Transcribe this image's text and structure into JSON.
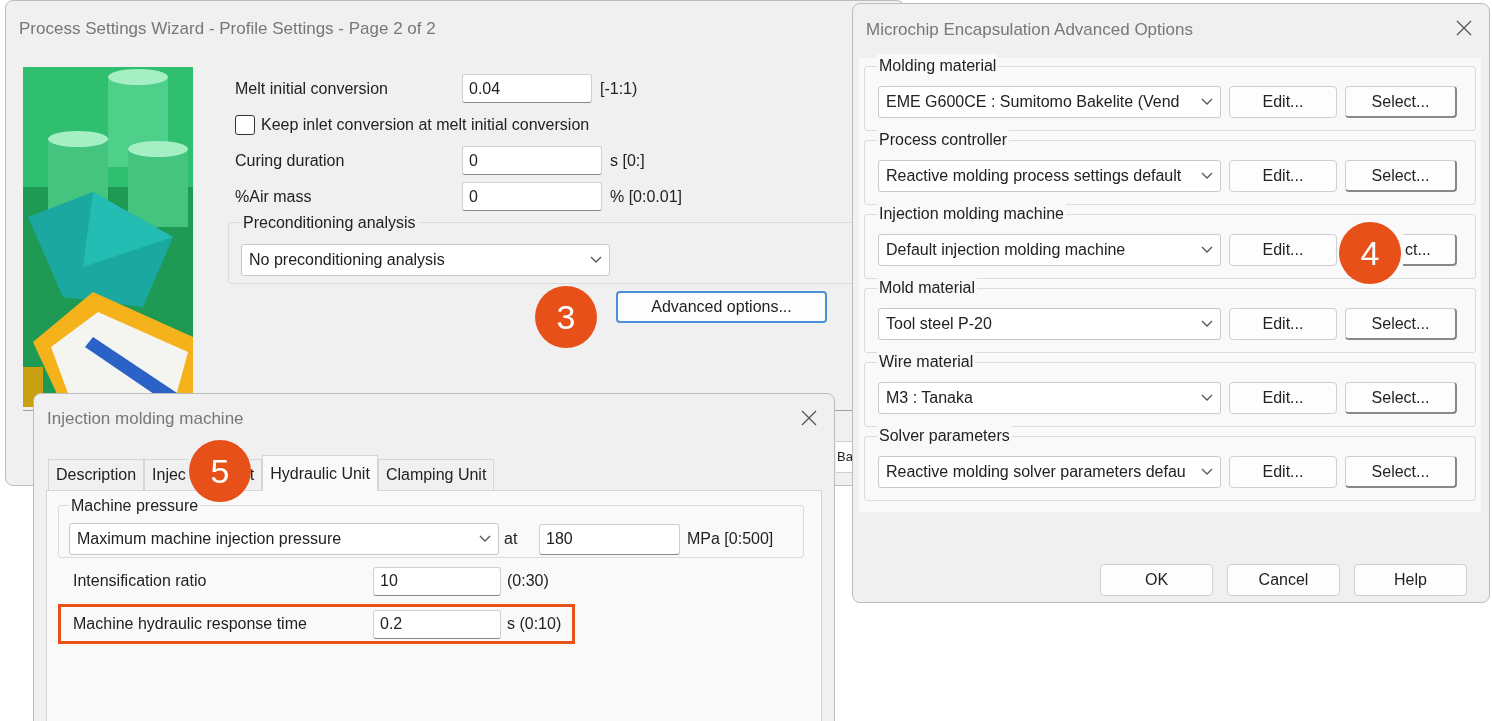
{
  "wizard": {
    "title": "Process Settings Wizard - Profile Settings - Page 2 of 2",
    "fields": [
      {
        "kind": "input",
        "label": "Melt initial conversion",
        "value": "0.04",
        "unit": "[-1:1)"
      },
      {
        "kind": "checkbox",
        "label": "Keep inlet conversion at melt initial conversion",
        "checked": false
      },
      {
        "kind": "input",
        "label": "Curing duration",
        "value": "0",
        "unit": "s [0:]"
      },
      {
        "kind": "input",
        "label": "%Air mass",
        "value": "0",
        "unit": "% [0:0.01]"
      }
    ],
    "preconditioning": {
      "label": "Preconditioning analysis",
      "value": "No preconditioning analysis"
    },
    "advanced_button": "Advanced options...",
    "badge": "3",
    "back_button": "Ba"
  },
  "advanced": {
    "title": "Microchip Encapsulation Advanced Options",
    "rows": [
      {
        "label": "Molding material",
        "value": "EME G600CE : Sumitomo Bakelite (Vend",
        "edit": "Edit...",
        "select": "Select..."
      },
      {
        "label": "Process controller",
        "value": "Reactive molding process settings default",
        "edit": "Edit...",
        "select": "Select..."
      },
      {
        "label": "Injection molding machine",
        "value": "Default injection molding machine",
        "edit": "Edit...",
        "select": "ct...",
        "badge": "4"
      },
      {
        "label": "Mold material",
        "value": "Tool steel P-20",
        "edit": "Edit...",
        "select": "Select..."
      },
      {
        "label": "Wire material",
        "value": "M3 : Tanaka",
        "edit": "Edit...",
        "select": "Select..."
      },
      {
        "label": "Solver parameters",
        "value": "Reactive molding solver parameters defau",
        "edit": "Edit...",
        "select": "Select..."
      }
    ],
    "buttons": [
      "OK",
      "Cancel",
      "Help"
    ]
  },
  "injection": {
    "title": "Injection molding machine",
    "tabs": [
      {
        "label": "Description",
        "selected": false
      },
      {
        "label": "Injec",
        "label_end": "t",
        "selected": false,
        "badge": "5"
      },
      {
        "label": "Hydraulic Unit",
        "selected": true
      },
      {
        "label": "Clamping Unit",
        "selected": false
      }
    ],
    "pressure_group": {
      "label": "Machine pressure",
      "value": "Maximum machine injection pressure",
      "at": "at",
      "amount": "180",
      "unit": "MPa [0:500]"
    },
    "fields": [
      {
        "label": "Intensification ratio",
        "value": "10",
        "unit": "(0:30)",
        "highlighted": false
      },
      {
        "label": "Machine hydraulic response time",
        "value": "0.2",
        "unit": "s (0:10)",
        "highlighted": true
      }
    ]
  }
}
